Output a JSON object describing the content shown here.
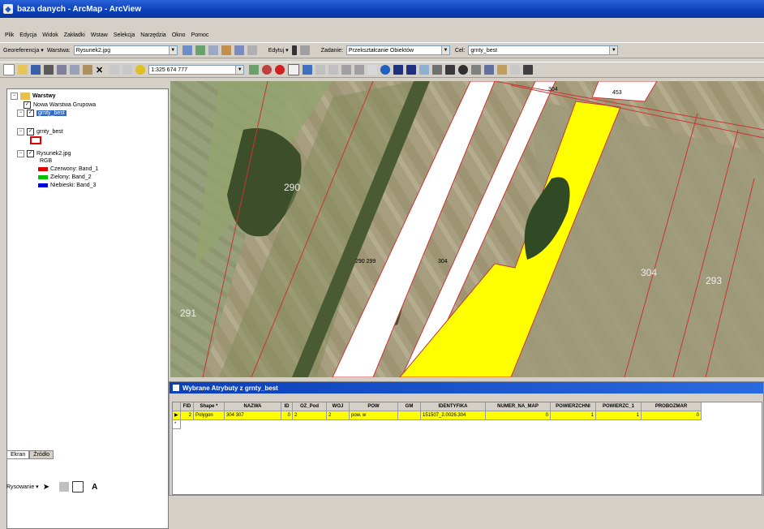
{
  "window": {
    "title": "baza danych - ArcMap - ArcView"
  },
  "menu": [
    "Plik",
    "Edycja",
    "Widok",
    "Zakładki",
    "Wstaw",
    "Selekcja",
    "Narzędzia",
    "Okno",
    "Pomoc"
  ],
  "georef_toolbar": {
    "label": "Georeferencja ▾",
    "layer_label": "Warstwa:",
    "layer_value": "Rysunek2.jpg"
  },
  "editor_toolbar": {
    "editor_label": "Edytuj ▾",
    "task_label": "Zadanie:",
    "task_value": "Przekształcanie Obiektów",
    "target_label": "Cel:",
    "target_value": "grnty_best"
  },
  "standard_toolbar": {
    "scale_value": "1:325 674 777"
  },
  "toc": {
    "root": "Warstwy",
    "items": [
      {
        "label": "Nowa Warstwa Grupowa",
        "checked": true
      },
      {
        "label": "grnty_best",
        "checked": true,
        "selected": true
      },
      {
        "label": "grnty_best",
        "checked": true
      },
      {
        "label": "Rysunek2.jpg",
        "checked": true
      },
      {
        "label": "RGB"
      },
      {
        "label": "Czerwony:   Band_1",
        "color": "#e00000"
      },
      {
        "label": "Zielony:  Band_2",
        "color": "#00c000"
      },
      {
        "label": "Niebieski:  Band_3",
        "color": "#0000e0"
      }
    ],
    "tabs": [
      "Ekran",
      "Źródło"
    ]
  },
  "draw_toolbar": {
    "label": "Rysowanie ▾",
    "text_tool": "A"
  },
  "map": {
    "parcel_labels": [
      "304",
      "453",
      "290 299",
      "304",
      "304",
      "290",
      "293",
      "291"
    ],
    "colors": {
      "selected": "#ffff00",
      "strip": "#ffffff",
      "parcel_border": "#cc3333"
    }
  },
  "attributes": {
    "title": "Wybrane Atrybuty z grnty_best",
    "columns": [
      "FID",
      "Shape *",
      "NAZWA",
      "ID",
      "OZ_Pod",
      "WOJ",
      "POW",
      "GM",
      "IDENTYFIKA",
      "NUMER_NA_MAP",
      "POWIERZCHNI",
      "POWIERZC_1",
      "PROBOZMAR"
    ],
    "rows": [
      [
        "2",
        "Polygon",
        "304 307",
        "0",
        "2",
        "2",
        "pow. w",
        "",
        "151507_2.0026.304",
        "0",
        "1",
        "1",
        "0"
      ]
    ]
  }
}
